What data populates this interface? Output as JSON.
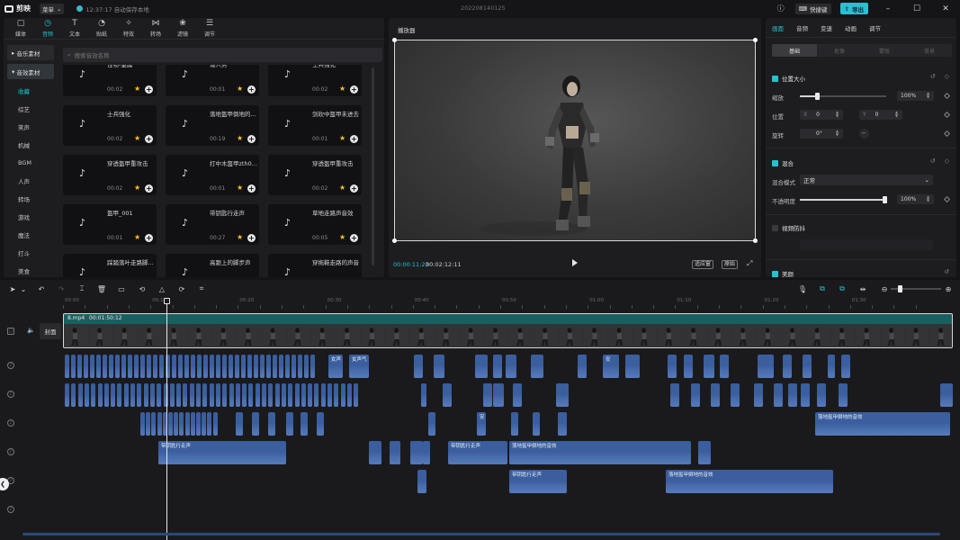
{
  "titlebar": {
    "app_name": "剪映",
    "menu_label": "菜单",
    "save_status": "12:37:17 自动保存本地",
    "project_name": "202208140125",
    "shortcut_label": "快捷键",
    "export_label": "导出"
  },
  "left_tabs": [
    {
      "label": "媒体",
      "icon": "▢"
    },
    {
      "label": "音频",
      "icon": "◷"
    },
    {
      "label": "文本",
      "icon": "T"
    },
    {
      "label": "贴纸",
      "icon": "◔"
    },
    {
      "label": "特效",
      "icon": "✧"
    },
    {
      "label": "转场",
      "icon": "⋈"
    },
    {
      "label": "滤镜",
      "icon": "❀"
    },
    {
      "label": "调节",
      "icon": "☰"
    }
  ],
  "categories": {
    "heads": [
      "音乐素材",
      "音效素材"
    ],
    "items": [
      "收藏",
      "综艺",
      "笑声",
      "机械",
      "BGM",
      "人声",
      "转场",
      "游戏",
      "魔法",
      "打斗",
      "美食"
    ]
  },
  "search": {
    "placeholder": "搜索音效名称"
  },
  "sound_cards": [
    {
      "name": "怪物-金属",
      "duration": "00:02"
    },
    {
      "name": "矮人男",
      "duration": "00:01"
    },
    {
      "name": "士兵强化",
      "duration": "00:02"
    },
    {
      "name": "士兵强化",
      "duration": "00:02"
    },
    {
      "name": "落地盔甲倒地的...",
      "duration": "00:19"
    },
    {
      "name": "剑砍中盔甲未进去",
      "duration": "00:01"
    },
    {
      "name": "穿透盔甲重攻击",
      "duration": "00:02"
    },
    {
      "name": "打中木盔甲zth0...",
      "duration": "00:01"
    },
    {
      "name": "穿透盔甲重攻击",
      "duration": "00:02"
    },
    {
      "name": "盔甲_001",
      "duration": "00:01"
    },
    {
      "name": "带钥匙行走声",
      "duration": "00:27"
    },
    {
      "name": "草地走路声音效",
      "duration": "00:05"
    },
    {
      "name": "踩踏落叶走路脚...",
      "duration": ""
    },
    {
      "name": "高跟上的脚步声",
      "duration": ""
    },
    {
      "name": "穿拖鞋走路的声音",
      "duration": ""
    }
  ],
  "player": {
    "title": "播放器",
    "time_current": "00:00:11:23",
    "time_total": "00:02:12:11",
    "fit_label": "适应窗",
    "ratio_label": "原始",
    "fullscreen_icon": "fullscreen-icon"
  },
  "right_panel": {
    "tabs": [
      "画面",
      "音频",
      "变速",
      "动画",
      "调节"
    ],
    "sub_tabs": [
      "基础",
      "抠像",
      "蒙版",
      "背景"
    ],
    "position_size": {
      "title": "位置大小",
      "scale_label": "缩放",
      "scale_value": "100%",
      "scale_fraction": 0.2,
      "position_label": "位置",
      "x_lead": "X",
      "x_value": "0",
      "y_lead": "Y",
      "y_value": "0",
      "rotate_label": "旋转",
      "rotate_value": "0°"
    },
    "blend": {
      "title": "混合",
      "mode_label": "混合模式",
      "mode_value": "正常",
      "opacity_label": "不透明度",
      "opacity_value": "100%",
      "opacity_fraction": 1.0
    },
    "stabilize": {
      "title": "视频防抖"
    },
    "beauty": {
      "title": "美颜"
    }
  },
  "timeline": {
    "ruler_labels": [
      "00:00",
      "00:10",
      "00:20",
      "00:30",
      "00:40",
      "00:50",
      "01:00",
      "01:10",
      "01:20",
      "01:30"
    ],
    "main_clip_name": "8.mp4",
    "main_clip_duration": "00:01:50:12",
    "cover_label": "封面",
    "audio_labels": {
      "a": "女声",
      "b": "女声气",
      "c": "带钥匙行走声",
      "d": "落地盔甲倒地的音效",
      "e": "带钥匙行走声",
      "f": "落地盔甲倒地的音效",
      "g": "带钥匙行走声",
      "h": "落地盔甲倒地的音效",
      "i": "落地盔甲倒地的音效"
    }
  },
  "colors": {
    "accent": "#27c1cf",
    "audio_clip": "#3a5e9e",
    "main_track": "#1a5f5f"
  }
}
